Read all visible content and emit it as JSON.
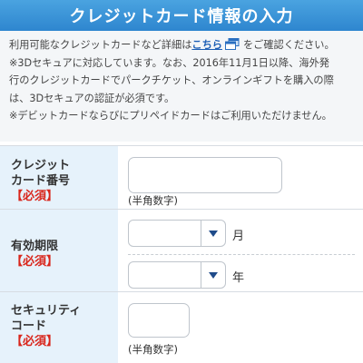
{
  "header": {
    "title": "クレジットカード情報の入力"
  },
  "notes": {
    "line1_prefix": "利用可能なクレジットカードなど詳細は",
    "link_text": "こちら",
    "line1_suffix": "をご確認ください。",
    "line2": "※3Dセキュアに対応しています。なお、2016年11月1日以降、海外発",
    "line3": "行のクレジットカードでパークチケット、オンラインギフトを購入の際",
    "line4": "は、3Dセキュアの認証が必須です。",
    "line5": "※デビットカードならびにプリペイドカードはご利用いただけません。"
  },
  "form": {
    "card_number": {
      "label_line1": "クレジット",
      "label_line2": "カード番号",
      "required": "【必須】",
      "hint": "(半角数字)"
    },
    "expiry": {
      "label": "有効期限",
      "required": "【必須】",
      "month_unit": "月",
      "year_unit": "年"
    },
    "security_code": {
      "label_line1": "セキュリティ",
      "label_line2": "コード",
      "required": "【必須】",
      "hint": "(半角数字)"
    }
  },
  "colors": {
    "header": "#2e86cf",
    "label_bg": "#e6f2fb",
    "required": "#d9261c",
    "link": "#1d5fb5",
    "caret": "#1f4b8a"
  }
}
